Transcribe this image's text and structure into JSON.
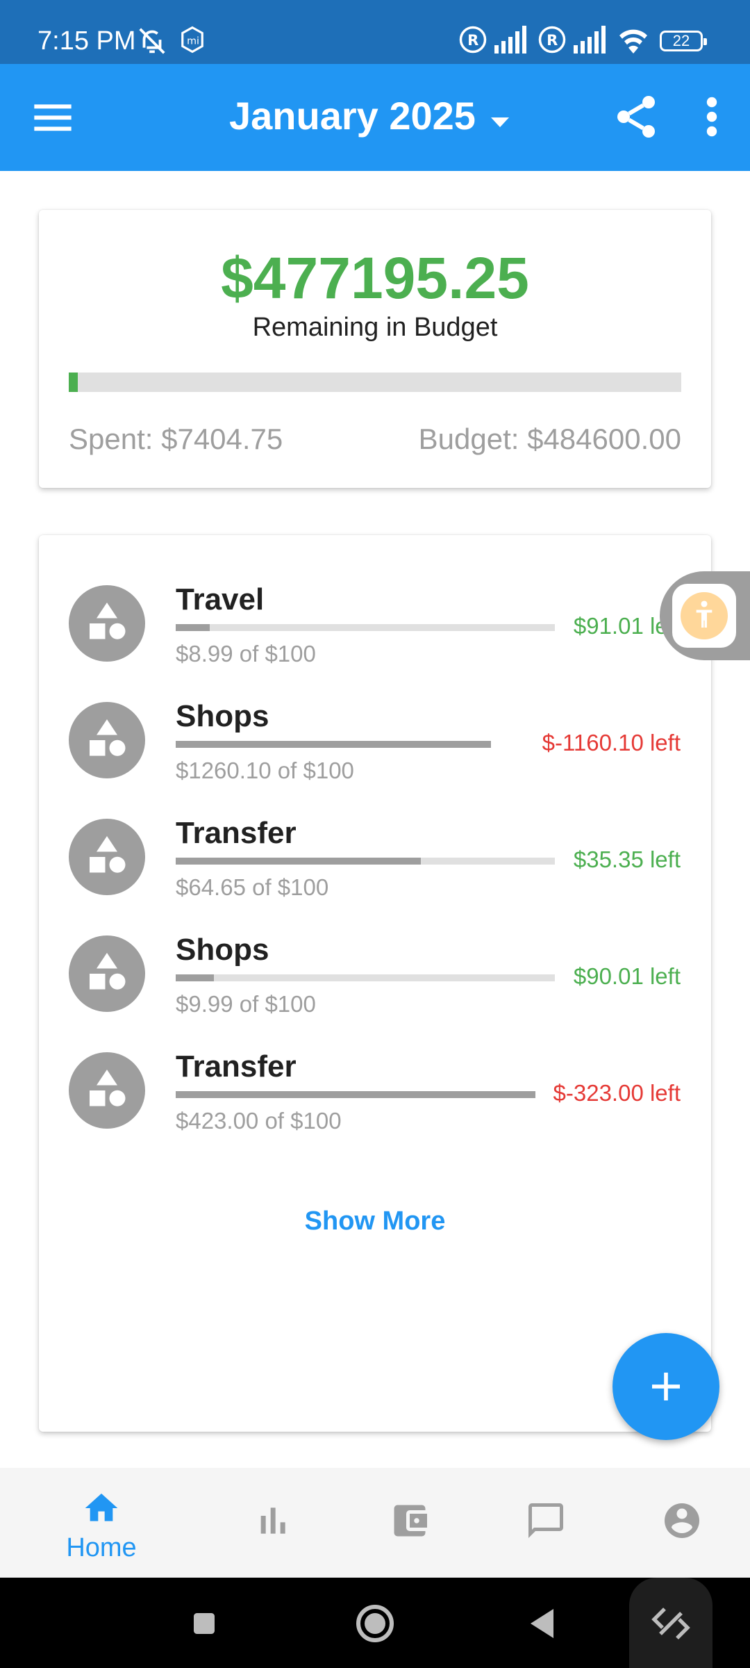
{
  "status_bar": {
    "time": "7:15 PM",
    "battery": "22"
  },
  "app_bar": {
    "title": "January 2025"
  },
  "summary": {
    "remaining": "$477195.25",
    "remaining_label": "Remaining in Budget",
    "spent": "Spent: $7404.75",
    "budget": "Budget: $484600.00",
    "progress_fraction": 0.015
  },
  "categories": [
    {
      "name": "Travel",
      "detail": "$8.99 of $100",
      "left": "$91.01 left",
      "status": "pos",
      "progress_fraction": 0.09
    },
    {
      "name": "Shops",
      "detail": "$1260.10 of $100",
      "left": "$-1160.10 left",
      "status": "neg",
      "progress_fraction": 1.0
    },
    {
      "name": "Transfer",
      "detail": "$64.65 of $100",
      "left": "$35.35 left",
      "status": "pos",
      "progress_fraction": 0.6465
    },
    {
      "name": "Shops",
      "detail": "$9.99 of $100",
      "left": "$90.01 left",
      "status": "pos",
      "progress_fraction": 0.0999
    },
    {
      "name": "Transfer",
      "detail": "$423.00 of $100",
      "left": "$-323.00 left",
      "status": "neg",
      "progress_fraction": 1.0
    }
  ],
  "show_more": "Show More",
  "bottom_nav": {
    "items": [
      {
        "label": "Home",
        "icon": "home-icon",
        "active": true
      },
      {
        "label": "",
        "icon": "bar-chart-icon",
        "active": false
      },
      {
        "label": "",
        "icon": "wallet-icon",
        "active": false
      },
      {
        "label": "",
        "icon": "chat-icon",
        "active": false
      },
      {
        "label": "",
        "icon": "account-icon",
        "active": false
      }
    ]
  },
  "colors": {
    "primary": "#2196f3",
    "status_bar": "#1e6fb8",
    "positive": "#4caf50",
    "negative": "#e53935",
    "muted": "#9e9e9e"
  }
}
